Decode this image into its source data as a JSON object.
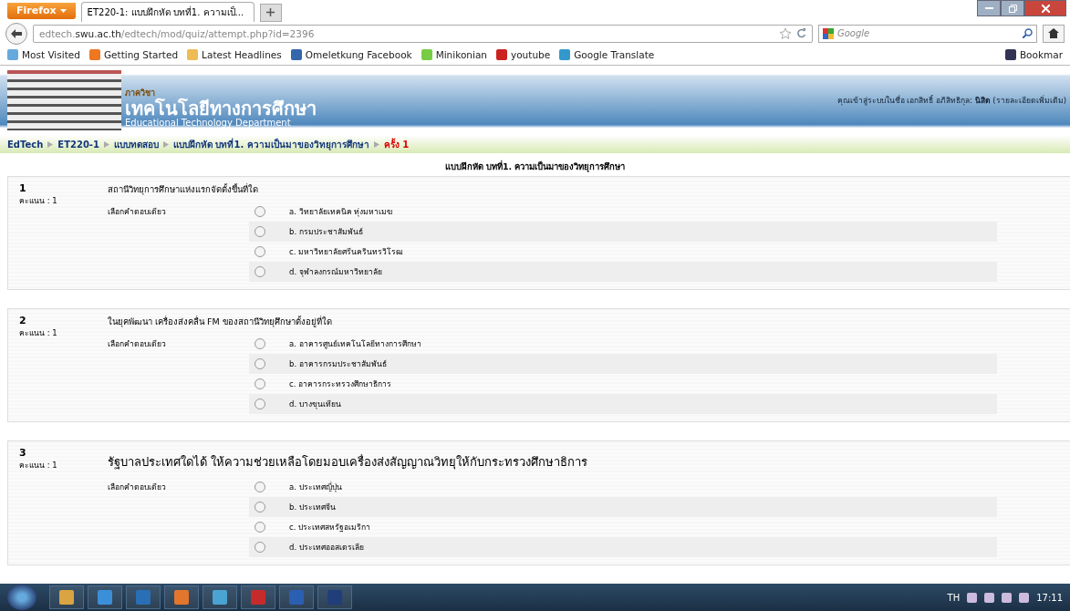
{
  "browser": {
    "menu_button": "Firefox",
    "tabs": [
      {
        "title": "ET220-1: แบบฝึกหัด บทที่1. ความเป็...",
        "selected": true
      }
    ],
    "url": {
      "host_prefix": "edtech.",
      "host": "swu.ac.th",
      "path": "/edtech/mod/quiz/attempt.php?id=2396"
    },
    "search_placeholder": "Google",
    "bookmarks": [
      "Most Visited",
      "Getting Started",
      "Latest Headlines",
      "Omeletkung Facebook",
      "Minikonian",
      "youtube",
      "Google Translate"
    ],
    "bookmarks_menu": "Bookmar"
  },
  "header": {
    "logo_small": "ภาควิชา",
    "logo_main": "เทคโนโลยีทางการศึกษา",
    "logo_sub": "Educational Technology Department",
    "login_text": "คุณเข้าสู่ระบบในชื่อ เอกสิทธิ์ อภิสิทธิกุล:",
    "login_role": "นิสิต",
    "login_link": "(รายละเอียดเพิ่มเติม)"
  },
  "breadcrumb": [
    {
      "label": "EdTech",
      "current": false
    },
    {
      "label": "ET220-1",
      "current": false
    },
    {
      "label": "แบบทดสอบ",
      "current": false
    },
    {
      "label": "แบบฝึกหัด บทที่1. ความเป็นมาของวิทยุการศึกษา",
      "current": false
    },
    {
      "label": "ครั้ง 1",
      "current": true
    }
  ],
  "quiz_title": "แบบฝึกหัด บทที่1. ความเป็นมาของวิทยุการศึกษา",
  "questions": [
    {
      "number": "1",
      "score": "คะแนน : 1",
      "text": "สถานีวิทยุการศึกษาแห่งแรกจัดตั้งขึ้นที่ใด",
      "large": false,
      "instruction": "เลือกคำตอบเดียว",
      "options": [
        {
          "label": "a. วิทยาลัยเทคนิค ทุ่งมหาเมฆ",
          "selected": false
        },
        {
          "label": "b. กรมประชาสัมพันธ์",
          "selected": false
        },
        {
          "label": "c. มหาวิทยาลัยศรีนครินทรวิโรฒ",
          "selected": false
        },
        {
          "label": "d. จุฬาลงกรณ์มหาวิทยาลัย",
          "selected": false
        }
      ]
    },
    {
      "number": "2",
      "score": "คะแนน : 1",
      "text": "ในยุคพัฒนา เครื่องส่งคลื่น FM ของสถานีวิทยุศึกษาตั้งอยู่ที่ใด",
      "large": false,
      "instruction": "เลือกคำตอบเดียว",
      "options": [
        {
          "label": "a. อาคารศูนย์เทคโนโลยีทางการศึกษา",
          "selected": false
        },
        {
          "label": "b. อาคารกรมประชาสัมพันธ์",
          "selected": false
        },
        {
          "label": "c. อาคารกระทรวงศึกษาธิการ",
          "selected": false
        },
        {
          "label": "d. บางขุนเทียน",
          "selected": false
        }
      ]
    },
    {
      "number": "3",
      "score": "คะแนน : 1",
      "text": "รัฐบาลประเทศใดได้ ให้ความช่วยเหลือโดยมอบเครื่องส่งสัญญาณวิทยุให้กับกระทรวงศึกษาธิการ",
      "large": true,
      "instruction": "เลือกคำตอบเดียว",
      "options": [
        {
          "label": "a. ประเทศญี่ปุ่น",
          "selected": false
        },
        {
          "label": "b. ประเทศจีน",
          "selected": false
        },
        {
          "label": "c. ประเทศสหรัฐอเมริกา",
          "selected": false
        },
        {
          "label": "d. ประเทศออสเตรเลีย",
          "selected": false
        }
      ]
    }
  ],
  "taskbar": {
    "language": "TH",
    "time": "17:11"
  }
}
